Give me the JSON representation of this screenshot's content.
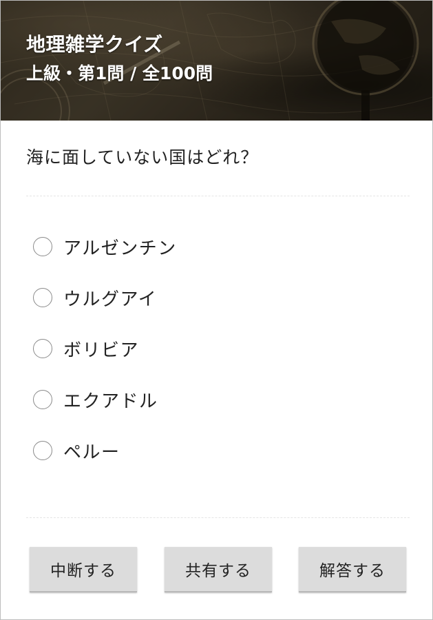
{
  "header": {
    "title": "地理雑学クイズ",
    "progress": "上級・第1問 / 全100問",
    "background": "antique-map-globe-image"
  },
  "question": {
    "text": "海に面していない国はどれ？"
  },
  "options": [
    {
      "label": "アルゼンチン",
      "selected": false
    },
    {
      "label": "ウルグアイ",
      "selected": false
    },
    {
      "label": "ボリビア",
      "selected": false
    },
    {
      "label": "エクアドル",
      "selected": false
    },
    {
      "label": "ペルー",
      "selected": false
    }
  ],
  "buttons": {
    "suspend": "中断する",
    "share": "共有する",
    "answer": "解答する"
  },
  "colors": {
    "button_bg": "#dcdcdc",
    "text": "#222222",
    "header_text": "#ffffff"
  }
}
